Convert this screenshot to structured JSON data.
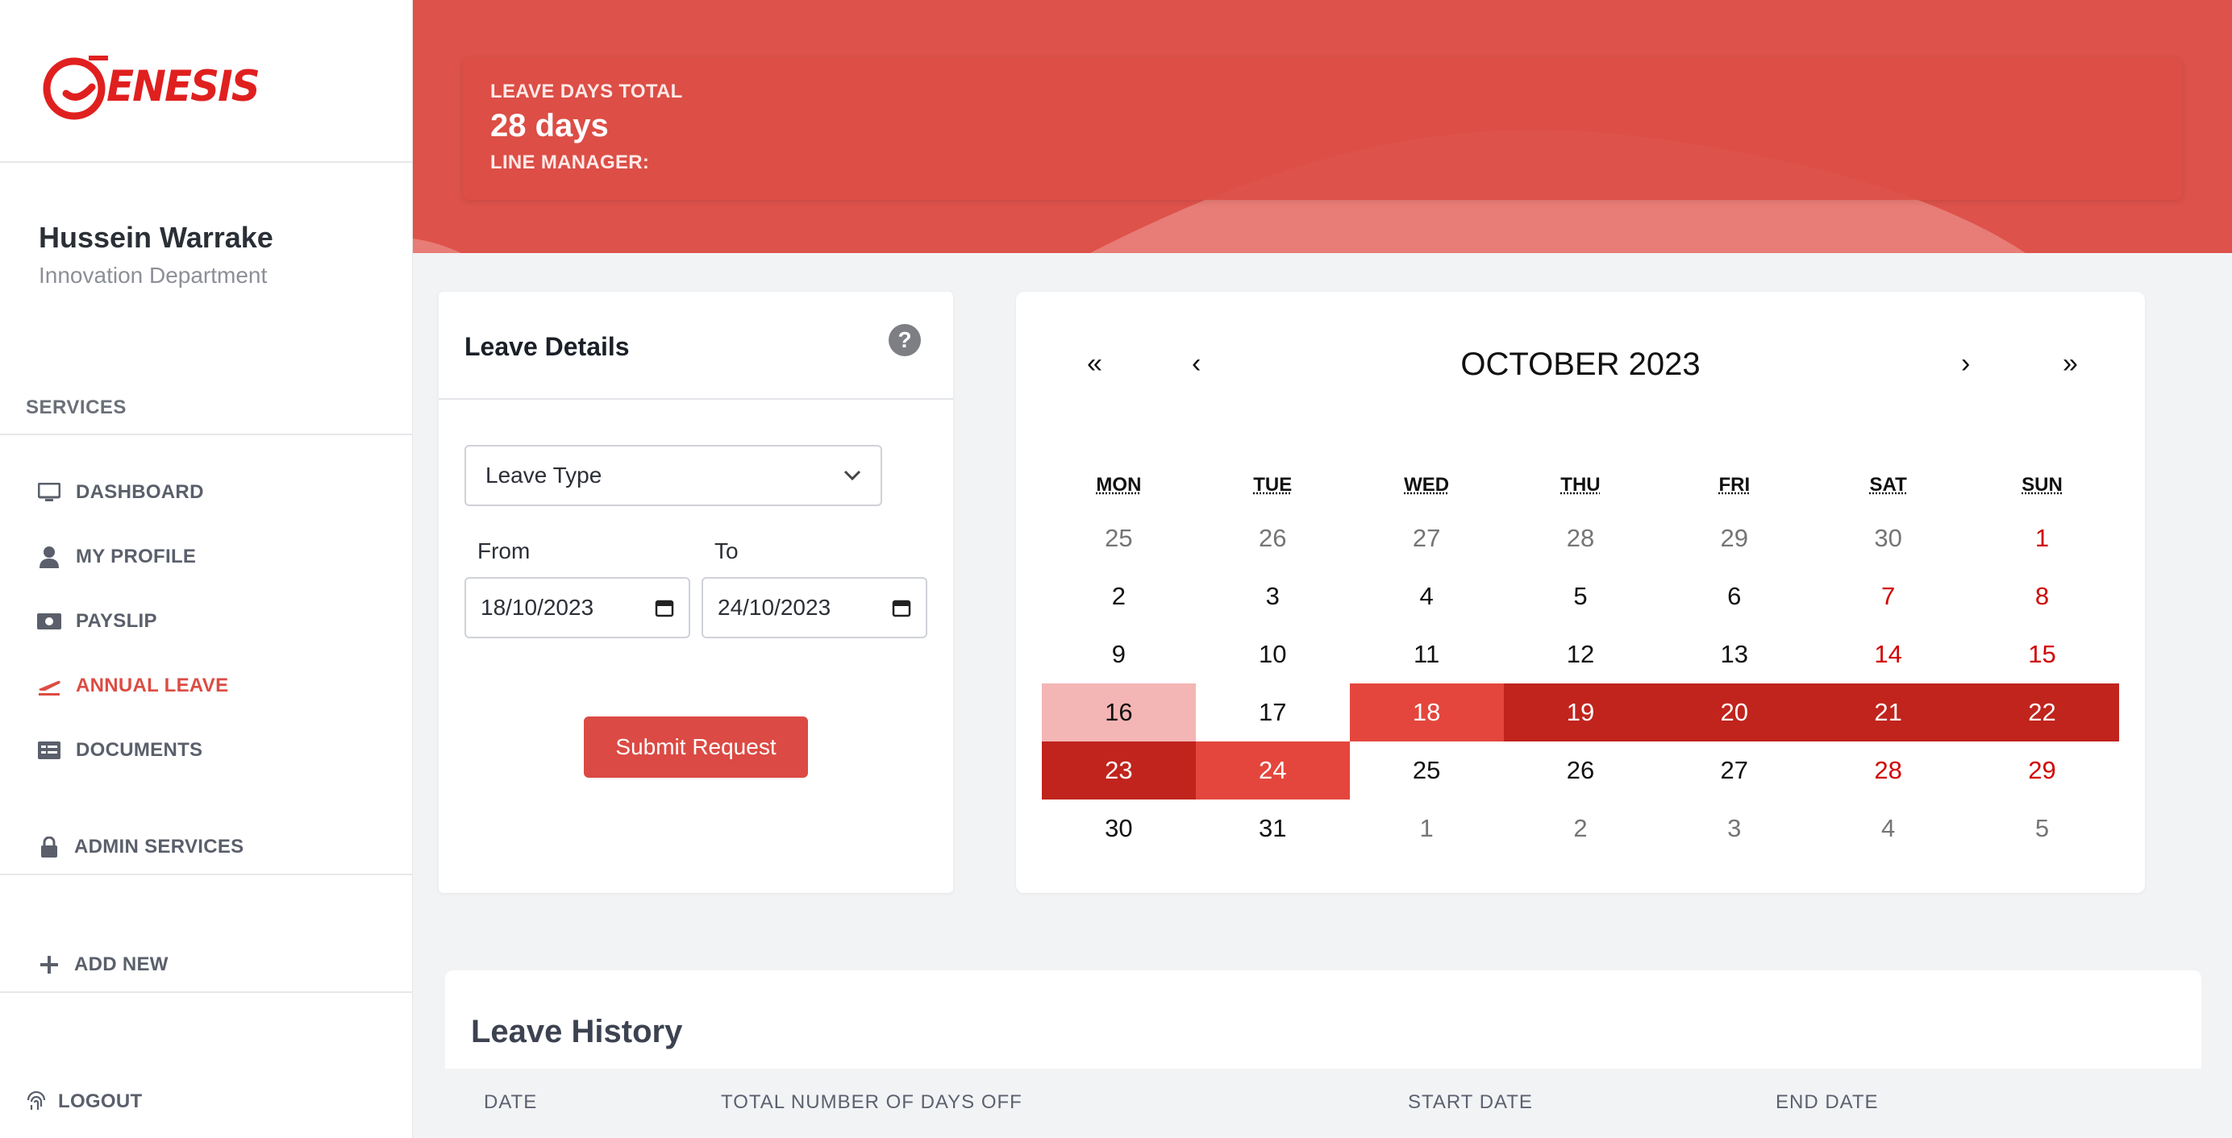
{
  "brand": {
    "logo_text": "ENESIS",
    "accent": "#dd524a"
  },
  "user": {
    "name": "Hussein Warrake",
    "department": "Innovation Department"
  },
  "sidebar": {
    "services_label": "SERVICES",
    "items": [
      {
        "label": "DASHBOARD",
        "icon": "monitor-icon"
      },
      {
        "label": "MY PROFILE",
        "icon": "user-icon"
      },
      {
        "label": "PAYSLIP",
        "icon": "cash-icon"
      },
      {
        "label": "ANNUAL LEAVE",
        "icon": "plane-icon",
        "active": true
      },
      {
        "label": "DOCUMENTS",
        "icon": "documents-icon"
      }
    ],
    "admin_label": "ADMIN SERVICES",
    "add_new_label": "ADD NEW",
    "logout_label": "LOGOUT"
  },
  "summary": {
    "total_label": "LEAVE DAYS TOTAL",
    "total_value": "28 days",
    "manager_label": "LINE MANAGER:"
  },
  "details": {
    "title": "Leave Details",
    "leave_type_placeholder": "Leave Type",
    "from_label": "From",
    "to_label": "To",
    "from_value": "18/10/2023",
    "to_value": "24/10/2023",
    "submit_label": "Submit Request"
  },
  "calendar": {
    "title": "OCTOBER 2023",
    "nav": {
      "prev_year": "«",
      "prev_month": "‹",
      "next_month": "›",
      "next_year": "»"
    },
    "weekdays": [
      "MON",
      "TUE",
      "WED",
      "THU",
      "FRI",
      "SAT",
      "SUN"
    ],
    "days": [
      {
        "d": "25",
        "s": "muted"
      },
      {
        "d": "26",
        "s": "muted"
      },
      {
        "d": "27",
        "s": "muted"
      },
      {
        "d": "28",
        "s": "muted"
      },
      {
        "d": "29",
        "s": "muted"
      },
      {
        "d": "30",
        "s": "muted"
      },
      {
        "d": "1",
        "s": "weekend"
      },
      {
        "d": "2",
        "s": ""
      },
      {
        "d": "3",
        "s": ""
      },
      {
        "d": "4",
        "s": ""
      },
      {
        "d": "5",
        "s": ""
      },
      {
        "d": "6",
        "s": ""
      },
      {
        "d": "7",
        "s": "weekend"
      },
      {
        "d": "8",
        "s": "weekend"
      },
      {
        "d": "9",
        "s": ""
      },
      {
        "d": "10",
        "s": ""
      },
      {
        "d": "11",
        "s": ""
      },
      {
        "d": "12",
        "s": ""
      },
      {
        "d": "13",
        "s": ""
      },
      {
        "d": "14",
        "s": "weekend"
      },
      {
        "d": "15",
        "s": "weekend"
      },
      {
        "d": "16",
        "s": "r1"
      },
      {
        "d": "17",
        "s": ""
      },
      {
        "d": "18",
        "s": "r2"
      },
      {
        "d": "19",
        "s": "r3"
      },
      {
        "d": "20",
        "s": "r3"
      },
      {
        "d": "21",
        "s": "r3"
      },
      {
        "d": "22",
        "s": "r3"
      },
      {
        "d": "23",
        "s": "r3"
      },
      {
        "d": "24",
        "s": "r2"
      },
      {
        "d": "25",
        "s": ""
      },
      {
        "d": "26",
        "s": ""
      },
      {
        "d": "27",
        "s": ""
      },
      {
        "d": "28",
        "s": "weekend"
      },
      {
        "d": "29",
        "s": "weekend"
      },
      {
        "d": "30",
        "s": ""
      },
      {
        "d": "31",
        "s": ""
      },
      {
        "d": "1",
        "s": "muted"
      },
      {
        "d": "2",
        "s": "muted"
      },
      {
        "d": "3",
        "s": "muted"
      },
      {
        "d": "4",
        "s": "muted"
      },
      {
        "d": "5",
        "s": "muted"
      }
    ]
  },
  "history": {
    "title": "Leave History",
    "columns": [
      "DATE",
      "TOTAL NUMBER OF DAYS OFF",
      "START DATE",
      "END DATE"
    ]
  }
}
